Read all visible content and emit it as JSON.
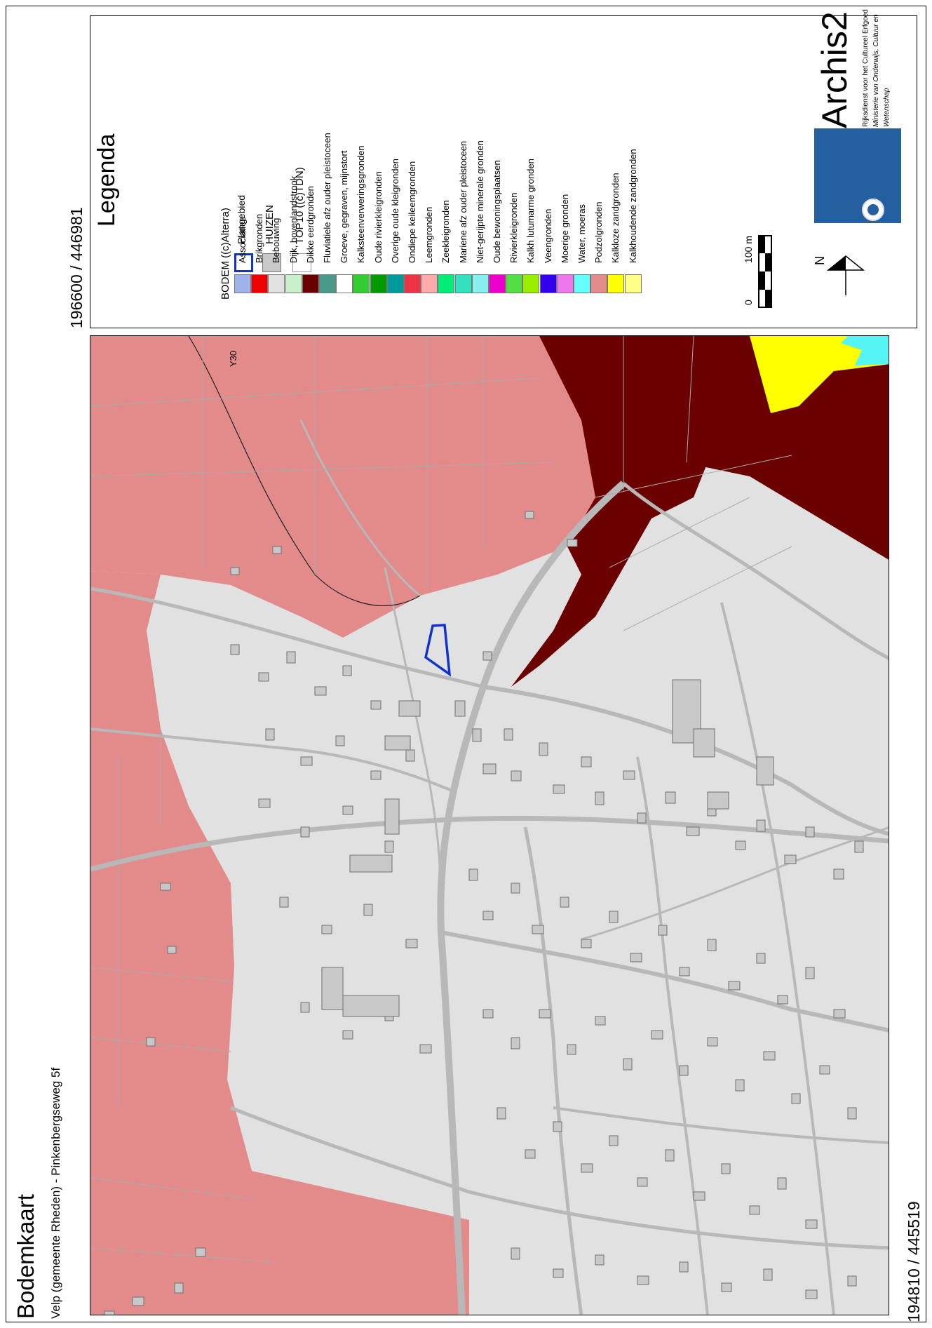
{
  "title": "Bodemkaart",
  "subtitle": "Velp (gemeente Rheden) - Pinkenbergseweg 5f",
  "coord_top_right": "196600 / 446981",
  "coord_bottom_left": "194810 / 445519",
  "map": {
    "label_y30": "Y30"
  },
  "legend": {
    "heading": "Legenda",
    "items": [
      {
        "label": "Plangebied",
        "fill": "#ffffff",
        "stroke": "#1133cc"
      },
      {
        "label": "HUIZEN",
        "fill": "#c8c8c8",
        "stroke": "#777777"
      },
      {
        "label": "TOP10 ((c)TDN)",
        "fill": "#ffffff",
        "stroke": "#999999"
      }
    ],
    "soil_heading": "BODEM ((c)Alterra)",
    "soil_items": [
      {
        "label": "Associaties",
        "color": "#9fb3ea"
      },
      {
        "label": "Brikgronden",
        "color": "#ee0000"
      },
      {
        "label": "Bebouwing",
        "color": "#e1e1e1"
      },
      {
        "label": "Dijk, bovenlandstrook",
        "color": "#c9f0c9"
      },
      {
        "label": "Dikke eerdgronden",
        "color": "#6b0000"
      },
      {
        "label": "Fluviatiele afz ouder pleistoceen",
        "color": "#4a9a8a"
      },
      {
        "label": "Groeve, gegraven, mijnstort",
        "color": "#ffffff"
      },
      {
        "label": "Kalksteenverweringsgronden",
        "color": "#33cc33"
      },
      {
        "label": "Oude rivierkleigronden",
        "color": "#009a00"
      },
      {
        "label": "Overige oude kleigronden",
        "color": "#009a9a"
      },
      {
        "label": "Ondiepe keileemgronden",
        "color": "#ee3344"
      },
      {
        "label": "Leemgronden",
        "color": "#ffaaaa"
      },
      {
        "label": "Zeekleigronden",
        "color": "#00ee77"
      },
      {
        "label": "Mariene afz ouder pleistoceen",
        "color": "#33e0c0"
      },
      {
        "label": "Niet-gerijpte minerale gronden",
        "color": "#88eeee"
      },
      {
        "label": "Oude bewoningsplaatsen",
        "color": "#ee00cc"
      },
      {
        "label": "Rivierkleigronden",
        "color": "#55dd44"
      },
      {
        "label": "Kalkh lutumarme gronden",
        "color": "#99ee00"
      },
      {
        "label": "Veengronden",
        "color": "#3300ee"
      },
      {
        "label": "Moerige gronden",
        "color": "#ee77ee"
      },
      {
        "label": "Water, moeras",
        "color": "#66ffff"
      },
      {
        "label": "Podzolgronden",
        "color": "#e38a8a"
      },
      {
        "label": "Kalkloze zandgronden",
        "color": "#ffff00"
      },
      {
        "label": "Kalkhoudende zandgronden",
        "color": "#ffff88"
      }
    ],
    "scale": {
      "zero": "0",
      "end": "100 m"
    },
    "north": "N",
    "brand": "Archis2",
    "org_line1": "Rijksdienst voor het Cultureel Erfgoed",
    "org_line2": "Ministerie van Onderwijs, Cultuur en",
    "org_line3": "Wetenschap"
  }
}
